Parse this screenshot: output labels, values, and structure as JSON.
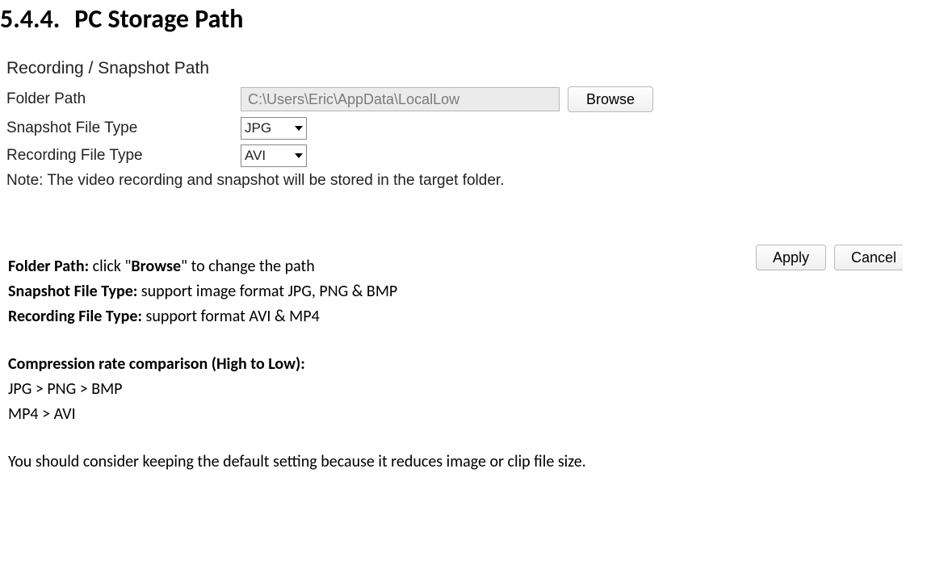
{
  "heading": {
    "number": "5.4.4.",
    "title": "PC Storage Path"
  },
  "panel": {
    "title": "Recording / Snapshot Path",
    "folder_label": "Folder Path",
    "folder_value": "C:\\Users\\Eric\\AppData\\LocalLow",
    "browse_label": "Browse",
    "snapshot_label": "Snapshot File Type",
    "snapshot_value": "JPG",
    "recording_label": "Recording File Type",
    "recording_value": "AVI",
    "note": "Note: The video recording and snapshot will be stored in the target folder.",
    "apply_label": "Apply",
    "cancel_label": "Cancel"
  },
  "descriptions": {
    "folder_path_label": "Folder Path:",
    "folder_path_text": " click \"",
    "folder_path_bold": "Browse",
    "folder_path_after": "\" to change the path",
    "snapshot_label": "Snapshot File Type:",
    "snapshot_text": " support image format JPG, PNG & BMP",
    "recording_label": "Recording File Type:",
    "recording_text": " support format AVI & MP4",
    "compression_title": "Compression rate comparison (High to Low):",
    "compression_img": "JPG > PNG > BMP",
    "compression_vid": "MP4 > AVI",
    "advice": "You should consider keeping the default setting because it reduces image or clip file size."
  }
}
